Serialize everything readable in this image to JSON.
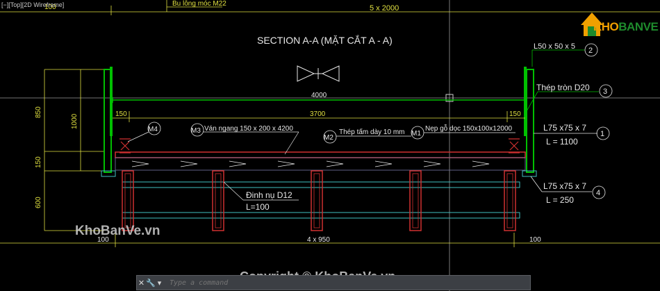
{
  "viewport": {
    "label": "[−][Top][2D Wireframe]",
    "parts": [
      "[−]",
      "[Top]",
      "[2D Wireframe]"
    ]
  },
  "drawing": {
    "title": "SECTION A-A (MẶT CẮT A - A)",
    "top_dim": "5 x 2000",
    "top_left_dim": "100",
    "bolt_note": "Bu lông móc M22",
    "dims": {
      "span": "4000",
      "inner": "3700",
      "left_offset": "150",
      "right_offset": "150",
      "h850": "850",
      "h1000": "1000",
      "h150": "150",
      "h600": "600",
      "bottom_left": "100",
      "bottom_mid": "4 x 950",
      "bottom_right": "100"
    },
    "callouts": {
      "c2_text": "L50 x 50 x 5",
      "c2_num": "2",
      "c3_text": "Thép tròn D20",
      "c3_num": "3",
      "c1_text": "L75 x75 x 7",
      "c1_sub": "L = 1100",
      "c1_num": "1",
      "c4_text": "L75 x75 x 7",
      "c4_sub": "L = 250",
      "c4_num": "4",
      "m1": "M1",
      "m1_text": "Nẹp gỗ dọc 150x100x12000",
      "m2": "M2",
      "m2_text": "Thép tấm dày 10 mm",
      "m3": "M3",
      "m3_text": "Ván ngang 150 x 200 x 4200",
      "m4": "M4",
      "nail_text": "Đinh nụ D12",
      "nail_sub": "L=100"
    }
  },
  "watermark": {
    "left": "KhoBanVe.vn",
    "center": "Copyright © KhoBanVe.vn"
  },
  "logo": {
    "text_a": "KHO",
    "text_b": "BANVE"
  },
  "command": {
    "placeholder": "Type a command"
  },
  "colors": {
    "background": "#000000",
    "structure_green": "#00c000",
    "dim_yellow": "#e0e040",
    "steel_red": "#d03030",
    "beam_cyan": "#40c0c0"
  }
}
